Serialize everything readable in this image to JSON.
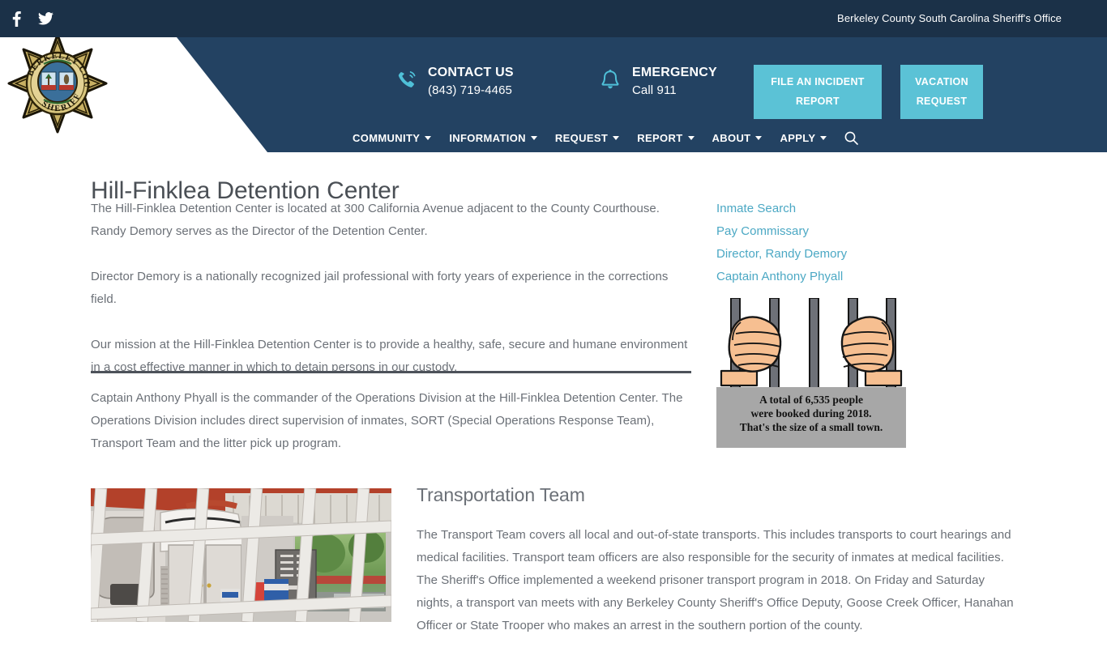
{
  "topbar": {
    "site_title": "Berkeley County South Carolina Sheriff's Office",
    "social": [
      {
        "name": "facebook-icon",
        "label": "Facebook"
      },
      {
        "name": "twitter-icon",
        "label": "Twitter"
      }
    ]
  },
  "header": {
    "logo_alt": "Berkeley County Sheriff Badge",
    "contact": {
      "icon": "phone-icon",
      "title": "CONTACT US",
      "phone": "(843) 719-4465"
    },
    "emergency": {
      "icon": "bell-icon",
      "title": "EMERGENCY",
      "detail": "Call 911"
    },
    "buttons": [
      {
        "label": "FILE AN INCIDENT REPORT",
        "name": "file-incident-report-button"
      },
      {
        "label": "VACATION REQUEST",
        "name": "vacation-request-button"
      }
    ],
    "nav": [
      {
        "label": "COMMUNITY",
        "has_caret": true
      },
      {
        "label": "INFORMATION",
        "has_caret": true
      },
      {
        "label": "REQUEST",
        "has_caret": true
      },
      {
        "label": "REPORT",
        "has_caret": true
      },
      {
        "label": "ABOUT",
        "has_caret": true
      },
      {
        "label": "APPLY",
        "has_caret": true
      }
    ],
    "search_icon": "search-icon"
  },
  "main": {
    "page_title": "Hill-Finklea Detention Center",
    "paragraphs": [
      "The Hill-Finklea Detention Center is located at 300 California Avenue adjacent to the County Courthouse. Randy Demory serves as the Director of the Detention Center.",
      "Director Demory is a nationally recognized jail professional with forty years of experience in the corrections field.",
      "Our mission at the Hill-Finklea Detention Center is to provide a healthy, safe, secure and humane environment in a cost effective manner in which to detain persons in our custody."
    ],
    "paragraph_after_divider": "Captain Anthony Phyall is the commander of the Operations Division at the Hill-Finklea Detention Center. The Operations Division includes direct supervision of inmates, SORT (Special Operations Response Team), Transport Team and the litter pick up program.",
    "sidebar_links": [
      "Inmate Search",
      "Pay Commissary",
      "Director, Randy Demory",
      "Captain Anthony Phyall"
    ],
    "jail_image": {
      "alt": "Hands gripping jail bars illustration",
      "caption_line1": "A total of 6,535 people",
      "caption_line2": "were booked during 2018.",
      "caption_line3": "That's the size of a small town."
    },
    "transport": {
      "image_alt": "Interior of prisoner transport van seen through a metal grate",
      "title": "Transportation Team",
      "body": "The Transport Team covers all local and out-of-state transports. This includes transports to court hearings and medical facilities. Transport team officers are also responsible for the security of inmates at medical facilities. The Sheriff's Office implemented a weekend prisoner transport program in 2018. On Friday and Saturday nights, a transport van meets with any Berkeley County Sheriff's Office Deputy, Goose Creek Officer, Hanahan Officer or State Trooper who makes an arrest in the southern portion of the county."
    }
  },
  "colors": {
    "topbar_bg": "#1b3148",
    "header_bg": "#234262",
    "accent_cyan": "#5bc2d6",
    "link_blue": "#4ba8c4",
    "body_text": "#6b7077",
    "title_text": "#4a4f55"
  }
}
